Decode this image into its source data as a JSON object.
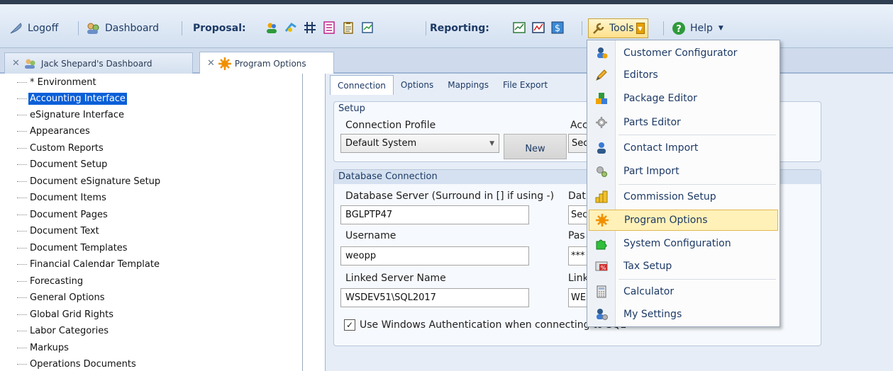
{
  "toolbar": {
    "logoff": "Logoff",
    "dashboard": "Dashboard",
    "proposal_label": "Proposal:",
    "reporting_label": "Reporting:",
    "tools": "Tools",
    "help": "Help"
  },
  "tabs": {
    "dashboard": "Jack Shepard's Dashboard",
    "program_options": "Program Options"
  },
  "tree": {
    "items": [
      "* Environment",
      "Accounting Interface",
      "eSignature Interface",
      "Appearances",
      "Custom Reports",
      "Document Setup",
      "Document eSignature Setup",
      "Document Items",
      "Document Pages",
      "Document Text",
      "Document Templates",
      "Financial Calendar Template",
      "Forecasting",
      "General Options",
      "Global Grid Rights",
      "Labor Categories",
      "Markups",
      "Operations Documents"
    ],
    "selected": "Accounting Interface"
  },
  "panel": {
    "tabs": [
      "Connection",
      "Options",
      "Mappings",
      "File Export"
    ],
    "setup": {
      "title": "Setup",
      "connection_profile_label": "Connection Profile",
      "connection_profile_value": "Default System",
      "new_button": "New",
      "acc_label": "Acc",
      "acc_value": "Sec"
    },
    "db": {
      "title": "Database Connection",
      "server_label": "Database Server (Surround in [] if using -)",
      "server_value": "BGLPTP47",
      "dat_label": "Dat",
      "dat_value": "Sec",
      "username_label": "Username",
      "username_value": "weopp",
      "pas_label": "Pas",
      "pas_value": "***",
      "linked_label": "Linked Server Name",
      "linked_value": "WSDEV51\\SQL2017",
      "link_label": "Link",
      "link_value": "WE",
      "windows_auth": "Use Windows Authentication when connecting to SQL",
      "windows_auth_checked": true
    }
  },
  "tools_menu": {
    "items": [
      {
        "label": "Customer Configurator",
        "icon": "customer-configurator-icon"
      },
      {
        "label": "Editors",
        "icon": "pencil-icon"
      },
      {
        "label": "Package Editor",
        "icon": "package-icon"
      },
      {
        "label": "Parts Editor",
        "icon": "gear-icon"
      },
      {
        "label": "Contact Import",
        "icon": "contact-icon"
      },
      {
        "label": "Part Import",
        "icon": "gears-icon"
      },
      {
        "label": "Commission Setup",
        "icon": "coins-icon"
      },
      {
        "label": "Program Options",
        "icon": "sun-gear-icon"
      },
      {
        "label": "System Configuration",
        "icon": "puzzle-icon"
      },
      {
        "label": "Tax Setup",
        "icon": "tax-icon"
      },
      {
        "label": "Calculator",
        "icon": "calculator-icon"
      },
      {
        "label": "My Settings",
        "icon": "settings-user-icon"
      }
    ],
    "highlighted": "Program Options"
  },
  "colors": {
    "accent": "#0a5fd8",
    "toolbar_text": "#1d3a66",
    "menu_highlight": "#fff1b8"
  }
}
